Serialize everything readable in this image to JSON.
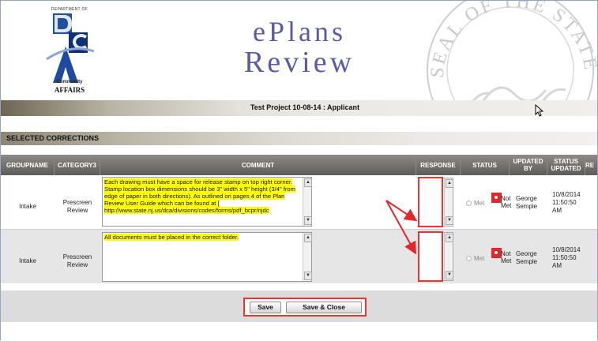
{
  "header": {
    "logo": {
      "department": "DEPARTMENT OF",
      "letters": "DCA",
      "community": "Community",
      "affairs": "AFFAIRS"
    },
    "title_line1": "ePlans",
    "title_line2": "Review",
    "seal_text": "SEAL OF THE STATE OF NE"
  },
  "project_bar": {
    "text": "Test Project 10-08-14 : Applicant"
  },
  "section": {
    "title": "SELECTED CORRECTIONS"
  },
  "table": {
    "columns": [
      "GROUPNAME",
      "CATEGORY3",
      "COMMENT",
      "RESPONSE",
      "STATUS",
      "UPDATED BY",
      "STATUS UPDATED",
      "RE"
    ],
    "rows": [
      {
        "group": "Intake",
        "category": "Prescreen Review",
        "comment": "Each drawing must have a space for release stamp on top right corner. Stamp location box dimensions should be 3\" width x 5\" height (3/4\" from edge of paper in both directions). As outlined on pages 4 of the Plan Review User Guide which can be found at [ http://www.state.nj.us/dca/divisions/codes/forms/pdf_bcpr/njdc",
        "response": "",
        "status_met": "Met",
        "status_not": "Not",
        "status_not2": "Met",
        "updated_by": "George Semple",
        "status_updated": "10/8/2014 11:50:50 AM"
      },
      {
        "group": "Intake",
        "category": "Prescreen Review",
        "comment": "All documents must be placed in the correct folder.",
        "response": "",
        "status_met": "Met",
        "status_not": "Not",
        "status_not2": "Met",
        "updated_by": "George Semple",
        "status_updated": "10/8/2014 11:50:50 AM"
      }
    ]
  },
  "buttons": {
    "save": "Save",
    "save_close": "Save & Close"
  },
  "colors": {
    "highlight": "#ffff00",
    "annotation_red": "#e3262b",
    "title_purple": "#5a5aa8"
  }
}
